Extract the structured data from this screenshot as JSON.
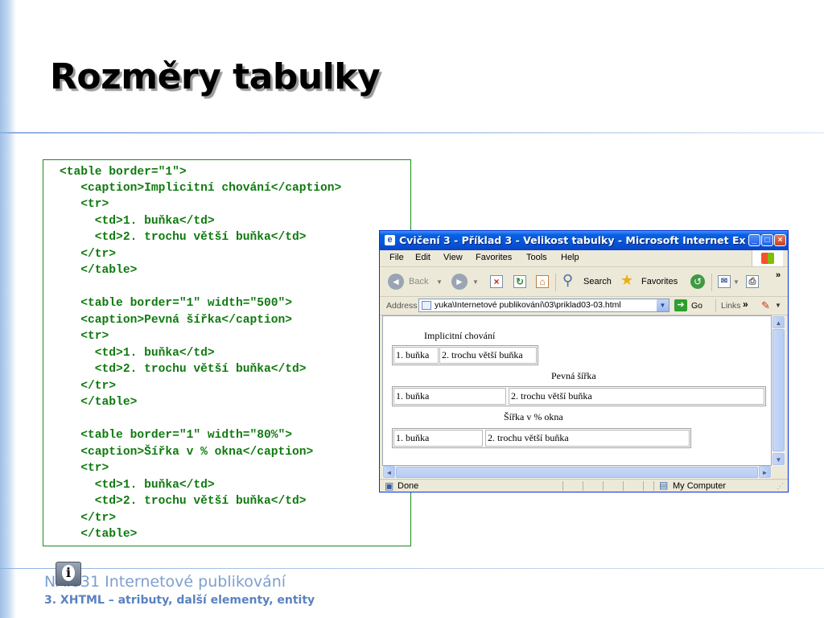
{
  "slide": {
    "title": "Rozměry tabulky",
    "footer_course": "NAI031 Internetové publikování",
    "footer_lecture": "3. XHTML – atributy, další elementy, entity",
    "info_icon": "info-icon"
  },
  "code": {
    "lines": [
      "<table border=\"1\">",
      "   <caption>Implicitní chování</caption>",
      "   <tr>",
      "     <td>1. buňka</td>",
      "     <td>2. trochu větší buňka</td>",
      "   </tr>",
      "   </table>",
      "",
      "   <table border=\"1\" width=\"500\">",
      "   <caption>Pevná šířka</caption>",
      "   <tr>",
      "     <td>1. buňka</td>",
      "     <td>2. trochu větší buňka</td>",
      "   </tr>",
      "   </table>",
      "",
      "   <table border=\"1\" width=\"80%\">",
      "   <caption>Šířka v % okna</caption>",
      "   <tr>",
      "     <td>1. buňka</td>",
      "     <td>2. trochu větší buňka</td>",
      "   </tr>",
      "   </table>"
    ],
    "color": "#0f7a0f"
  },
  "browser": {
    "window_title": "Cvičení 3 - Příklad 3 - Velikost tabulky - Microsoft Internet Exp...",
    "menu": [
      "File",
      "Edit",
      "View",
      "Favorites",
      "Tools",
      "Help"
    ],
    "toolbar": {
      "back_label": "Back",
      "search_label": "Search",
      "favorites_label": "Favorites"
    },
    "address_label": "Address",
    "address_value": "yuka\\Internetové publikování\\03\\priklad03-03.html",
    "go_label": "Go",
    "links_label": "Links",
    "status_text": "Done",
    "zone_text": "My Computer",
    "titlebar_color": "#0555dc",
    "demo": {
      "tables": [
        {
          "caption": "Implicitní chování",
          "cells": [
            "1. buňka",
            "2. trochu větší buňka"
          ]
        },
        {
          "caption": "Pevná šířka",
          "cells": [
            "1. buňka",
            "2. trochu větší buňka"
          ]
        },
        {
          "caption": "Šířka v % okna",
          "cells": [
            "1. buňka",
            "2. trochu větší buňka"
          ]
        }
      ]
    }
  }
}
